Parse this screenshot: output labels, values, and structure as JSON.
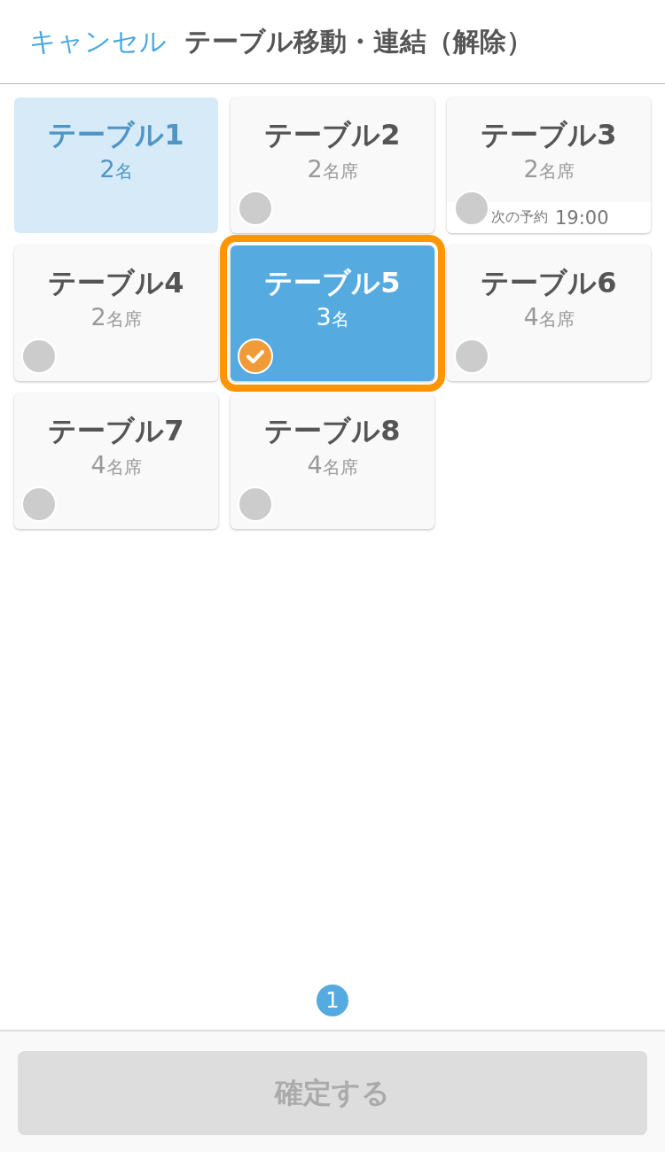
{
  "header": {
    "cancel": "キャンセル",
    "title": "テーブル移動・連結（解除）"
  },
  "tables": [
    {
      "name": "テーブル1",
      "count": "2",
      "unit": "名",
      "occupied": true,
      "disabled": true,
      "selected": false
    },
    {
      "name": "テーブル2",
      "count": "2",
      "unit": "名席",
      "occupied": false,
      "disabled": false,
      "selected": false
    },
    {
      "name": "テーブル3",
      "count": "2",
      "unit": "名席",
      "occupied": false,
      "disabled": false,
      "selected": false,
      "reservation": {
        "label": "次の予約",
        "time": "19:00"
      }
    },
    {
      "name": "テーブル4",
      "count": "2",
      "unit": "名席",
      "occupied": false,
      "disabled": false,
      "selected": false
    },
    {
      "name": "テーブル5",
      "count": "3",
      "unit": "名",
      "occupied": true,
      "disabled": false,
      "selected": true
    },
    {
      "name": "テーブル6",
      "count": "4",
      "unit": "名席",
      "occupied": false,
      "disabled": false,
      "selected": false
    },
    {
      "name": "テーブル7",
      "count": "4",
      "unit": "名席",
      "occupied": false,
      "disabled": false,
      "selected": false
    },
    {
      "name": "テーブル8",
      "count": "4",
      "unit": "名席",
      "occupied": false,
      "disabled": false,
      "selected": false
    }
  ],
  "pager": {
    "current": "1"
  },
  "footer": {
    "confirm_button": {
      "label": "確定する",
      "disabled": true
    }
  }
}
